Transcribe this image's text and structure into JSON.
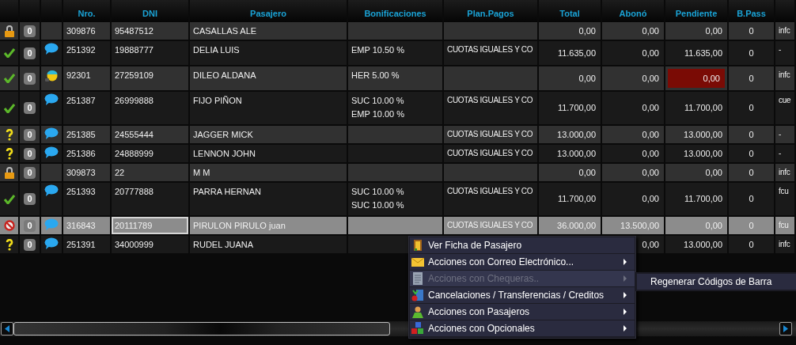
{
  "columns": [
    "",
    "",
    "",
    "Nro.",
    "DNI",
    "Pasajero",
    "Bonificaciones",
    "Plan.Pagos",
    "Total",
    "Abonó",
    "Pendiente",
    "B.Pass",
    ""
  ],
  "rows": [
    {
      "status": {
        "kind": "lock"
      },
      "count": "0",
      "nro": "309876",
      "dni": "95487512",
      "pasajero": "CASALLAS ALE",
      "bonificaciones": [],
      "plan": "",
      "total": "0,00",
      "abono": "0,00",
      "pendiente": "0,00",
      "pendiente_alert": false,
      "bpass": "0",
      "column_13": "infc",
      "selected": false
    },
    {
      "status": {
        "kind": "check"
      },
      "count": "0",
      "note": {
        "kind": "chat"
      },
      "nro": "251392",
      "dni": "19888777",
      "pasajero": "DELIA LUIS",
      "bonificaciones": [
        "EMP 10.50 %"
      ],
      "plan": "CUOTAS IGUALES Y CO",
      "total": "11.635,00",
      "abono": "0,00",
      "pendiente": "11.635,00",
      "pendiente_alert": false,
      "bpass": "0",
      "column_13": "-",
      "selected": false
    },
    {
      "status": {
        "kind": "check"
      },
      "count": "0",
      "note": {
        "kind": "avatar"
      },
      "nro": "92301",
      "dni": "27259109",
      "pasajero": "DILEO ALDANA",
      "bonificaciones": [
        "HER 5.00 %"
      ],
      "plan": "",
      "total": "0,00",
      "abono": "0,00",
      "pendiente": "0,00",
      "pendiente_alert": true,
      "bpass": "0",
      "column_13": "infc",
      "selected": false
    },
    {
      "status": {
        "kind": "check"
      },
      "count": "0",
      "note": {
        "kind": "chat"
      },
      "nro": "251387",
      "dni": "26999888",
      "pasajero": "FIJO PIÑON",
      "bonificaciones": [
        "SUC 10.00 %",
        "EMP 10.00 %"
      ],
      "plan": "CUOTAS IGUALES Y CO",
      "total": "11.700,00",
      "abono": "0,00",
      "pendiente": "11.700,00",
      "pendiente_alert": false,
      "bpass": "0",
      "column_13": "cue",
      "selected": false
    },
    {
      "status": {
        "kind": "question"
      },
      "count": "0",
      "note": {
        "kind": "chat"
      },
      "nro": "251385",
      "dni": "24555444",
      "pasajero": "JAGGER MICK",
      "bonificaciones": [],
      "plan": "CUOTAS IGUALES Y CO",
      "total": "13.000,00",
      "abono": "0,00",
      "pendiente": "13.000,00",
      "pendiente_alert": false,
      "bpass": "0",
      "column_13": "-",
      "selected": false
    },
    {
      "status": {
        "kind": "question"
      },
      "count": "0",
      "note": {
        "kind": "chat"
      },
      "nro": "251386",
      "dni": "24888999",
      "pasajero": "LENNON JOHN",
      "bonificaciones": [],
      "plan": "CUOTAS IGUALES Y CO",
      "total": "13.000,00",
      "abono": "0,00",
      "pendiente": "13.000,00",
      "pendiente_alert": false,
      "bpass": "0",
      "column_13": "-",
      "selected": false
    },
    {
      "status": {
        "kind": "lock"
      },
      "count": "0",
      "nro": "309873",
      "dni": "22",
      "pasajero": "M M",
      "bonificaciones": [],
      "plan": "",
      "total": "0,00",
      "abono": "0,00",
      "pendiente": "0,00",
      "pendiente_alert": false,
      "bpass": "0",
      "column_13": "infc",
      "selected": false
    },
    {
      "status": {
        "kind": "check"
      },
      "count": "0",
      "note": {
        "kind": "chat"
      },
      "nro": "251393",
      "dni": "20777888",
      "pasajero": "PARRA HERNAN",
      "bonificaciones": [
        "SUC 10.00 %",
        "SUC 10.00 %"
      ],
      "plan": "CUOTAS IGUALES Y CO",
      "total": "11.700,00",
      "abono": "0,00",
      "pendiente": "11.700,00",
      "pendiente_alert": false,
      "bpass": "0",
      "column_13": "fcu",
      "selected": false
    },
    {
      "status": {
        "kind": "blocked"
      },
      "count": "0",
      "note": {
        "kind": "chat"
      },
      "nro": "316843",
      "dni": "20111789",
      "pasajero": "PIRULON PIRULO juan",
      "bonificaciones": [],
      "plan": "CUOTAS IGUALES Y CO",
      "total": "36.000,00",
      "abono": "13.500,00",
      "pendiente": "0,00",
      "pendiente_alert": false,
      "bpass": "0",
      "column_13": "fcu",
      "selected": true
    },
    {
      "status": {
        "kind": "question"
      },
      "count": "0",
      "note": {
        "kind": "chat"
      },
      "nro": "251391",
      "dni": "34000999",
      "pasajero": "RUDEL JUANA",
      "bonificaciones": [],
      "plan": "",
      "total": "",
      "abono": "0,00",
      "pendiente": "13.000,00",
      "pendiente_alert": false,
      "bpass": "0",
      "column_13": "infc",
      "selected": false
    }
  ],
  "context_menu": [
    {
      "kind": "door",
      "label": "Ver Ficha de Pasajero",
      "submenu": false,
      "disabled": false,
      "expanded": false
    },
    {
      "kind": "envelope",
      "label": "Acciones con Correo Electrónico...",
      "submenu": true,
      "disabled": false,
      "expanded": false
    },
    {
      "kind": "document",
      "label": "Acciones con Chequeras..",
      "submenu": true,
      "disabled": true,
      "expanded": true
    },
    {
      "kind": "transfer",
      "label": "Cancelaciones / Transferencias / Creditos",
      "submenu": true,
      "disabled": false,
      "expanded": false
    },
    {
      "kind": "person",
      "label": "Acciones con Pasajeros",
      "submenu": true,
      "disabled": false,
      "expanded": false
    },
    {
      "kind": "blocks",
      "label": "Acciones con Opcionales",
      "submenu": true,
      "disabled": false,
      "expanded": false
    }
  ],
  "submenu": [
    {
      "label": "Regenerar Códigos de Barra"
    }
  ]
}
